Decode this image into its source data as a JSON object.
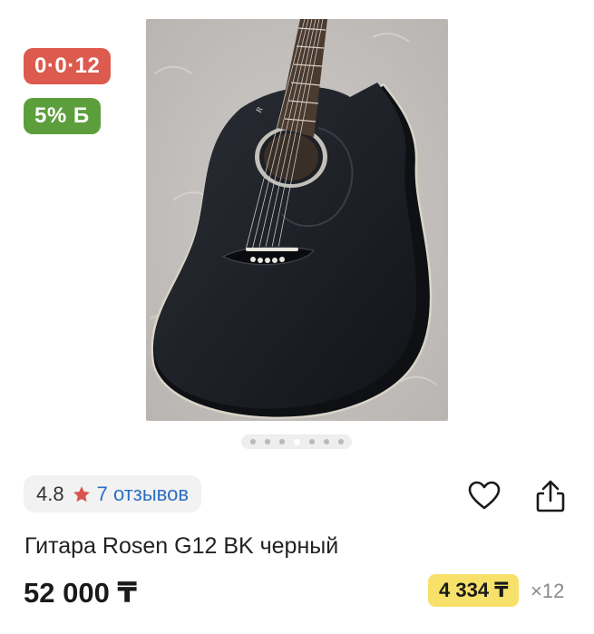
{
  "gallery": {
    "badge_installment": "0·0·12",
    "badge_bonus": "5% Б",
    "image_count": 7,
    "active_image_index": 3
  },
  "rating": {
    "value": "4.8",
    "reviews_label": "7 отзывов"
  },
  "icons": {
    "favorite": "heart-icon",
    "share": "share-icon",
    "rating": "star-icon"
  },
  "product": {
    "title": "Гитара Rosen G12 BK черный",
    "price": "52 000 ₸",
    "monthly_payment": "4 334 ₸",
    "months": "×12"
  },
  "colors": {
    "installment_badge": "#dd5a4f",
    "bonus_badge": "#5c9e3c",
    "monthly_highlight": "#f7e16a",
    "star": "#d9534f",
    "link": "#2d6ec4"
  }
}
